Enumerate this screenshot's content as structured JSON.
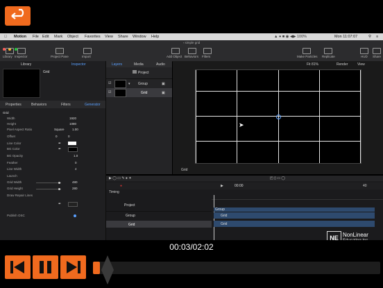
{
  "back_button": {
    "color": "#f06a1e"
  },
  "menubar": {
    "items": [
      "Motion",
      "File",
      "Edit",
      "Mark",
      "Object",
      "Favorites",
      "View",
      "Share",
      "Window",
      "Help"
    ],
    "clock": "Mon 11:07:07",
    "right_icon_names": [
      "search-icon",
      "menu-icon"
    ]
  },
  "window_title": "simple grid",
  "toolbar": {
    "left": [
      "Library",
      "Inspector",
      "Project Pane",
      "Import"
    ],
    "center": [
      "Add Object",
      "Behaviors",
      "Filters"
    ],
    "right": [
      "Make Particles",
      "Replicate",
      "HUD",
      "Share"
    ]
  },
  "library_tab": "Library",
  "library_sub": "Inspector",
  "preview_name": "Grid",
  "inspector_tabs": [
    "Properties",
    "Behaviors",
    "Filters",
    "Generator"
  ],
  "params": [
    {
      "label": "Grid",
      "value": ""
    },
    {
      "label": "Width",
      "value": "1920"
    },
    {
      "label": "Height",
      "value": "1080"
    },
    {
      "label": "Pixel Aspect Ratio",
      "value": "Square"
    },
    {
      "label": "Offset",
      "value": "0"
    },
    {
      "label": "Line Color",
      "value": ""
    },
    {
      "label": "BG Color",
      "value": ""
    },
    {
      "label": "BG Opacity",
      "value": "1.0"
    },
    {
      "label": "Feather",
      "value": "0"
    },
    {
      "label": "Line Width",
      "value": "4"
    },
    {
      "label": "Launch",
      "value": ""
    },
    {
      "label": "Grid Width",
      "value": "480"
    },
    {
      "label": "Grid Height",
      "value": "280"
    },
    {
      "label": "Draw Repair Lines",
      "value": ""
    },
    {
      "label": "Publish OSC",
      "value": ""
    }
  ],
  "layers": {
    "tabs": [
      "Layers",
      "Media",
      "Audio"
    ],
    "project": "Project",
    "group": "Group",
    "grid": "Grid"
  },
  "canvas_top": {
    "fit": "Fit 81%",
    "render": "Render",
    "view": "View"
  },
  "canvas_caption": "Grid",
  "timeline": {
    "title": "Timing",
    "project": "Project",
    "group": "Group",
    "grid": "Grid",
    "bar_group": "Group",
    "bar_grid": "Grid",
    "bar_grid2": "Grid",
    "frame_left": "00:00",
    "frame_right": "40"
  },
  "watermark": {
    "line1": "NonLinear",
    "line2": "Educating Inc.",
    "logo": "NE"
  },
  "player": {
    "time": "00:03/02:02",
    "progress": 0.025
  }
}
